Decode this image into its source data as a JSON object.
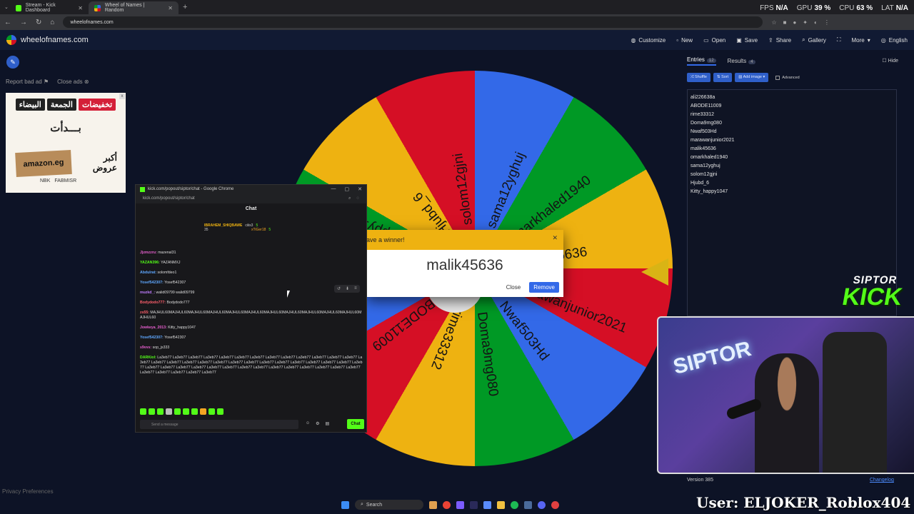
{
  "browser": {
    "tabs": [
      {
        "title": "Stream - Kick Dashboard",
        "active": false
      },
      {
        "title": "Wheel of Names | Random",
        "active": true
      }
    ],
    "url": "wheelofnames.com"
  },
  "hud": {
    "fps_label": "FPS",
    "fps": "N/A",
    "gpu_label": "GPU",
    "gpu": "39 %",
    "cpu_label": "CPU",
    "cpu": "63 %",
    "lat_label": "LAT",
    "lat": "N/A"
  },
  "site": {
    "logo": "wheelofnames.com",
    "menu": [
      "Customize",
      "New",
      "Open",
      "Save",
      "Share",
      "Gallery",
      "More",
      "English"
    ]
  },
  "ads": {
    "report": "Report bad ad",
    "close": "Close ads",
    "banner": {
      "pill1": "تخفيضات",
      "pill2": "الجمعة",
      "pill3": "البيضاء",
      "headline": "بـــدأت",
      "brand": "amazon.eg",
      "offer1": "أكبر",
      "offer2": "عروض",
      "bank1": "NBK",
      "bank2": "FABMISR"
    }
  },
  "privacy": "Privacy Preferences",
  "wheel": {
    "entries": [
      "malik45636",
      "omarkhaled1940",
      "sama12yghuj",
      "solom12gjni",
      "Hjubd_6",
      "Kitty_happy1047",
      "ali226638a",
      "ABODE11009",
      "rime33312",
      "Doma9mg080",
      "Nwaf503Hd",
      "marawanjunior2021"
    ],
    "colors": [
      "#3369e8",
      "#009925",
      "#eeb211",
      "#d50f25"
    ]
  },
  "winner": {
    "header": "We have a winner!",
    "header_visible": "ave a winner!",
    "name": "malik45636",
    "close": "Close",
    "remove": "Remove"
  },
  "chat": {
    "window_title": "kick.com/popout/siptor/chat - Google Chrome",
    "url": "kick.com/popout/siptor/chat",
    "header": "Chat",
    "pinned": [
      {
        "name": "IBRAHEM_SHIQBAWE",
        "count": "35"
      },
      {
        "name": "ciiis3",
        "count": "5"
      },
      {
        "name": "xTiGer18",
        "count": "5"
      }
    ],
    "messages": [
      {
        "user": "Jjzmzzru:",
        "text": " mazenal31",
        "color": "#e85fd0"
      },
      {
        "user": "YAZAN396:",
        "text": " YAZANMXJ",
        "color": "#53fc18"
      },
      {
        "user": "Abdulrat:",
        "text": " solomfdeo1",
        "color": "#5fa8ff"
      },
      {
        "user": "Yosef542307:",
        "text": " Yosef542307",
        "color": "#5fa8ff"
      },
      {
        "user": "muzkd_:",
        "text": " walid09799 walid09799",
        "color": "#c07dff"
      },
      {
        "user": "Bodydodo777:",
        "text": " Bodydodo777",
        "color": "#ff5f6b"
      },
      {
        "user": "zs55:",
        "text": " MAJHUL60MAJHUL60MAJHUL60MAJHUL60MAJHUL60MAJHUL60MAJHUL60MAJHUL60MAJHUL60MAJHUL60MAJHUL60MAJHUL60",
        "color": "#ff5f6b"
      },
      {
        "user": "Jowkeya_2013:",
        "text": " Kitty_happy1047",
        "color": "#e85fd0"
      },
      {
        "user": "Yosef542307:",
        "text": " Yosef542307",
        "color": "#5fa8ff"
      },
      {
        "user": "s9vvs:",
        "text": " sop_js333",
        "color": "#e85fd0"
      },
      {
        "user": "DARKiol:",
        "text": " La3eb77 La3eb77 La3eb77 La3eb77 La3eb77 La3eb77 La3eb77 La3eb77 La3eb77 La3eb77 La3eb77 La3eb77 La3eb77 La3eb77 La3eb77 La3eb77 La3eb77 La3eb77 La3eb77 La3eb77 La3eb77 La3eb77 La3eb77 La3eb77 La3eb77 La3eb77 La3eb77 La3eb77 La3eb77 La3eb77 La3eb77 La3eb77 La3eb77 La3eb77 La3eb77 La3eb77 La3eb77 La3eb77 La3eb77 La3eb77 La3eb77 La3eb77 La3eb77 La3eb77 La3eb77 La3eb77 La3eb77",
        "color": "#53fc18"
      }
    ],
    "input_placeholder": "Send a message",
    "send": "Chat"
  },
  "panel": {
    "tab_entries": "Entries",
    "entries_count": "12",
    "tab_results": "Results",
    "results_count": "4",
    "hide": "Hide",
    "shuffle": "Shuffle",
    "sort": "Sort",
    "add_image": "Add image",
    "advanced": "Advanced",
    "entries": [
      "ali226638a",
      "ABODE11009",
      "rime33312",
      "Doma9mg080",
      "Nwaf503Hd",
      "marawanjunior2021",
      "malik45636",
      "omarkhaled1940",
      "sama12yghuj",
      "solom12gjni",
      "Hjubd_6",
      "Kitty_happy1047"
    ],
    "version": "Version 385",
    "changelog": "Changelog"
  },
  "overlay": {
    "brand_top": "SIPTOR",
    "brand_bottom": "KICK",
    "neon": "SIPTOR",
    "user_tag": "User: ELJOKER_Roblox404"
  },
  "taskbar": {
    "search": "Search"
  }
}
